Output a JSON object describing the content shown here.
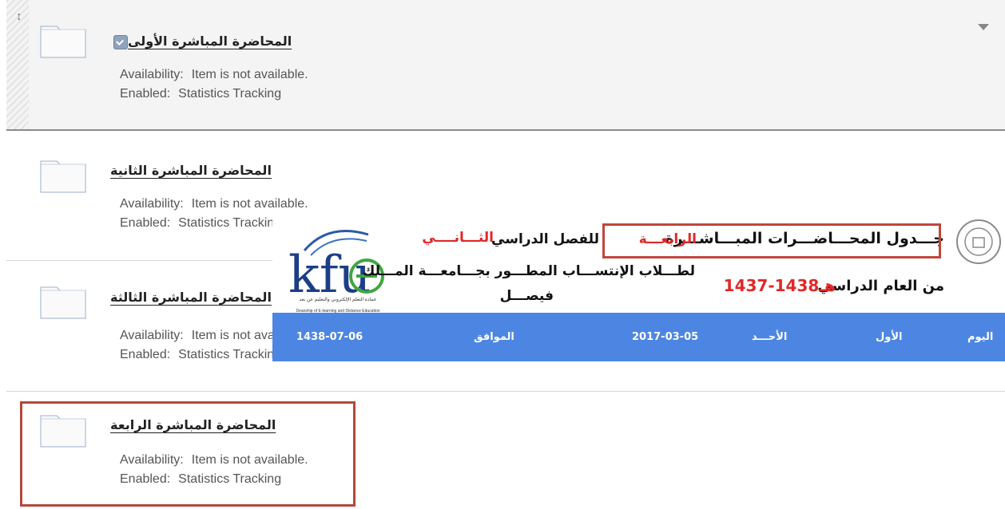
{
  "items": [
    {
      "title": "المحاضرة المباشرة الأولى",
      "availability_label": "Availability:",
      "availability_value": "Item is not available.",
      "enabled_label": "Enabled:",
      "enabled_value": "Statistics Tracking"
    },
    {
      "title": "المحاضرة المباشرة الثانية",
      "availability_label": "Availability:",
      "availability_value": "Item is not available.",
      "enabled_label": "Enabled:",
      "enabled_value": "Statistics Tracking"
    },
    {
      "title": "المحاضرة المباشرة الثالثة",
      "availability_label": "Availability:",
      "availability_value": "Item is not available.",
      "enabled_label": "Enabled:",
      "enabled_value": "Statistics Tracking"
    },
    {
      "title": "المحاضرة المباشرة الرابعة",
      "availability_label": "Availability:",
      "availability_value": "Item is not available.",
      "enabled_label": "Enabled:",
      "enabled_value": "Statistics Tracking"
    }
  ],
  "icons": {
    "drag": "drag-handle-icon",
    "folder": "folder-icon",
    "menu": "context-menu-icon",
    "collapse": "collapse-arrow-icon"
  },
  "banner": {
    "title": "جـــدول المحـــاضـــرات المبـــاشـــرة",
    "ordinal": "الرابعـــة",
    "semester_label": "للفصل الدراسي",
    "semester": "الثـــانــــي",
    "students_line": "لطـــلاب الإنتســـاب المطـــور بجـــامعـــة المـــلك",
    "university_tail": "فيصـــل",
    "year_label": "من العام الدراسي",
    "year_value": "1437-1438هـ",
    "logo_text": "kfu",
    "logo_caption_ar": "عمادة التعلم الإلكتروني والتعليم عن بعد",
    "logo_caption_en": "Deanship of E-learning and Distance Education",
    "schedule": {
      "day_label": "اليوم",
      "day_value": "الأول",
      "weekday": "الأحـــد",
      "gregorian": "2017-03-05",
      "corresponding_label": "الموافق",
      "hijri": "1438-07-06"
    }
  },
  "colors": {
    "highlight": "#b5473a",
    "bar": "#4d86e2",
    "red_text": "#e02828"
  }
}
